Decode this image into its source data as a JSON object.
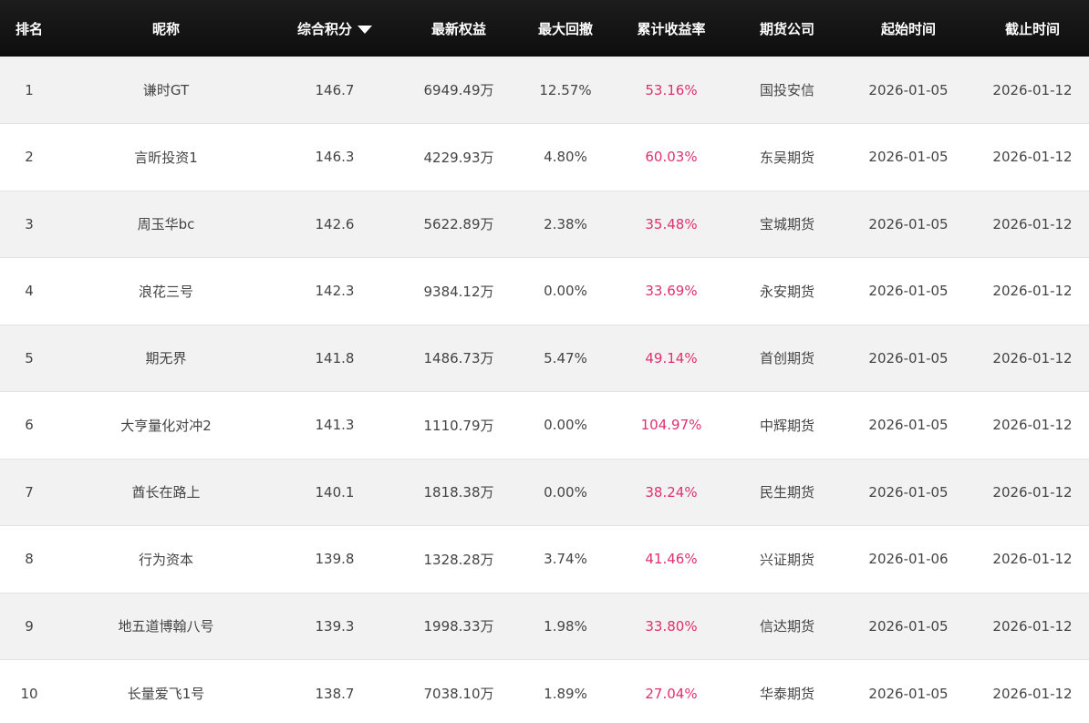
{
  "header": {
    "rank": "排名",
    "nickname": "昵称",
    "score": "综合积分",
    "equity": "最新权益",
    "drawdown": "最大回撤",
    "return": "累计收益率",
    "broker": "期货公司",
    "start": "起始时间",
    "end": "截止时间"
  },
  "sort_icon": "sort-desc-icon",
  "colors": {
    "header_bg": "#141414",
    "return_text": "#e0306e",
    "row_alt": "#f2f2f2"
  },
  "rows": [
    {
      "rank": "1",
      "nickname": "谦时GT",
      "score": "146.7",
      "equity": "6949.49万",
      "drawdown": "12.57%",
      "return": "53.16%",
      "broker": "国投安信",
      "start": "2026-01-05",
      "end": "2026-01-12"
    },
    {
      "rank": "2",
      "nickname": "言昕投资1",
      "score": "146.3",
      "equity": "4229.93万",
      "drawdown": "4.80%",
      "return": "60.03%",
      "broker": "东吴期货",
      "start": "2026-01-05",
      "end": "2026-01-12"
    },
    {
      "rank": "3",
      "nickname": "周玉华bc",
      "score": "142.6",
      "equity": "5622.89万",
      "drawdown": "2.38%",
      "return": "35.48%",
      "broker": "宝城期货",
      "start": "2026-01-05",
      "end": "2026-01-12"
    },
    {
      "rank": "4",
      "nickname": "浪花三号",
      "score": "142.3",
      "equity": "9384.12万",
      "drawdown": "0.00%",
      "return": "33.69%",
      "broker": "永安期货",
      "start": "2026-01-05",
      "end": "2026-01-12"
    },
    {
      "rank": "5",
      "nickname": "期无界",
      "score": "141.8",
      "equity": "1486.73万",
      "drawdown": "5.47%",
      "return": "49.14%",
      "broker": "首创期货",
      "start": "2026-01-05",
      "end": "2026-01-12"
    },
    {
      "rank": "6",
      "nickname": "大亨量化对冲2",
      "score": "141.3",
      "equity": "1110.79万",
      "drawdown": "0.00%",
      "return": "104.97%",
      "broker": "中辉期货",
      "start": "2026-01-05",
      "end": "2026-01-12"
    },
    {
      "rank": "7",
      "nickname": "酋长在路上",
      "score": "140.1",
      "equity": "1818.38万",
      "drawdown": "0.00%",
      "return": "38.24%",
      "broker": "民生期货",
      "start": "2026-01-05",
      "end": "2026-01-12"
    },
    {
      "rank": "8",
      "nickname": "行为资本",
      "score": "139.8",
      "equity": "1328.28万",
      "drawdown": "3.74%",
      "return": "41.46%",
      "broker": "兴证期货",
      "start": "2026-01-06",
      "end": "2026-01-12"
    },
    {
      "rank": "9",
      "nickname": "地五道博翰八号",
      "score": "139.3",
      "equity": "1998.33万",
      "drawdown": "1.98%",
      "return": "33.80%",
      "broker": "信达期货",
      "start": "2026-01-05",
      "end": "2026-01-12"
    },
    {
      "rank": "10",
      "nickname": "长量爱飞1号",
      "score": "138.7",
      "equity": "7038.10万",
      "drawdown": "1.89%",
      "return": "27.04%",
      "broker": "华泰期货",
      "start": "2026-01-05",
      "end": "2026-01-12"
    }
  ]
}
